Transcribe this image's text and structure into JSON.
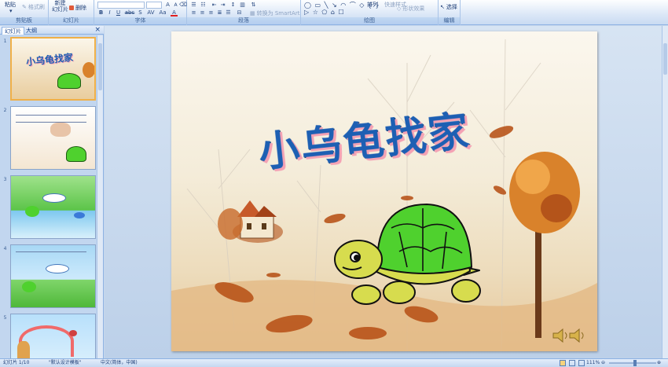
{
  "ribbon": {
    "clipboard": {
      "paste": "粘贴",
      "format_painter": "格式刷",
      "label": "剪贴板"
    },
    "slides": {
      "new_slide_line1": "新建",
      "new_slide_line2": "幻灯片",
      "delete": "删除",
      "label": "幻灯片"
    },
    "font": {
      "label": "字体",
      "bold": "B",
      "italic": "I",
      "underline": "U",
      "strike": "abc",
      "spacing": "AV",
      "case": "Aa",
      "color": "A"
    },
    "paragraph": {
      "label": "段落",
      "smartart": "转换为 SmartArt"
    },
    "drawing": {
      "label": "绘图",
      "arrange": "排列",
      "quick_styles": "快速样式",
      "shape_effects": "形状效果"
    },
    "editing": {
      "label": "编辑",
      "select": "选择"
    }
  },
  "panel": {
    "tab_slides": "幻灯片",
    "tab_outline": "大纲",
    "close": "×",
    "thumbnails": [
      {
        "number": "1",
        "title": "小乌龟找家"
      },
      {
        "number": "2"
      },
      {
        "number": "3"
      },
      {
        "number": "4"
      },
      {
        "number": "5"
      }
    ]
  },
  "slide": {
    "title": "小乌龟找家"
  },
  "status": {
    "slide_indicator": "幻灯片 1/10",
    "theme": "\"默认设计模板\"",
    "language": "中文(简体，中国)",
    "zoom": "111%",
    "zoom_fraction": 0.55
  },
  "colors": {
    "title": "#1d5fb3",
    "title_shadow": "#f4a2b4",
    "turtle_shell": "#4fd12e",
    "turtle_body": "#d7dc4e",
    "selection": "#f0b048"
  }
}
